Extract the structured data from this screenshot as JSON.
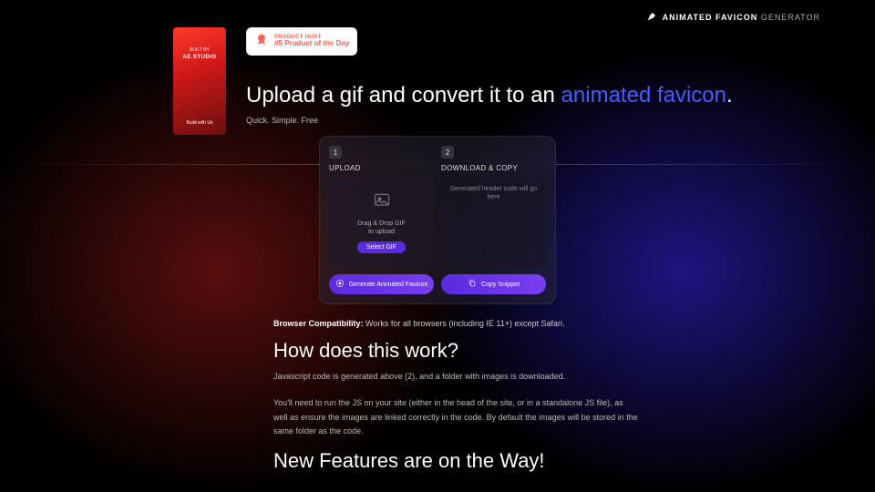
{
  "header": {
    "bold": "ANIMATED FAVICON",
    "light": "GENERATOR"
  },
  "sidebar": {
    "built": "BUILT BY",
    "studio": "AE.STUDIO",
    "cta": "Build with Us"
  },
  "ph": {
    "top": "PRODUCT HUNT",
    "bottom": "#5 Product of the Day"
  },
  "hero": {
    "part1": "Upload a gif and convert it to an ",
    "accent": "animated favicon",
    "part2": ".",
    "sub": "Quick. Simple. Free"
  },
  "app": {
    "step1_num": "1",
    "step1_label": "UPLOAD",
    "step2_num": "2",
    "step2_label": "DOWNLOAD & COPY",
    "dz_line1": "Drag & Drop GIF",
    "dz_line2": "to upload",
    "select_btn": "Select GIF",
    "code_placeholder": "Generated header code will go here",
    "generate_btn": "Generate Animated Favicon",
    "copy_btn": "Copy Snippet"
  },
  "compat": {
    "label": "Browser Compatibility:",
    "text": " Works for all browsers (including IE 11+) except Safari."
  },
  "section1": {
    "title": "How does this work?",
    "p1": "Javascript code is generated above (2), and a folder with images is downloaded.",
    "p2": "You'll need to run the JS on your site (either in the head of the site, or in a standalone JS file), as well as ensure the images are linked correctly in the code. By default the images will be stored in the same folder as the code."
  },
  "section2": {
    "title": "New Features are on the Way!"
  }
}
